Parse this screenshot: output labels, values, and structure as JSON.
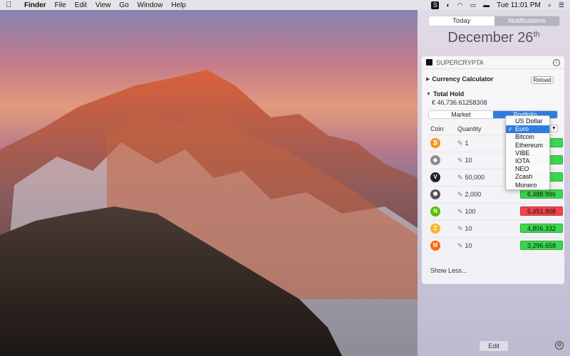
{
  "menubar": {
    "app": "Finder",
    "items": [
      "File",
      "Edit",
      "View",
      "Go",
      "Window",
      "Help"
    ],
    "clock": "Tue 11:01 PM"
  },
  "notification_center": {
    "tabs": {
      "today": "Today",
      "notifications": "Notifications"
    },
    "date_main": "December 26",
    "date_suffix": "th",
    "edit_label": "Edit"
  },
  "widget": {
    "title": "SUPERCRYPTA",
    "calculator_label": "Currency Calculator",
    "reload_label": "Reload",
    "total_hold_label": "Total Hold",
    "total_hold_value": "€ 46,736.61258308",
    "tab_market": "Market",
    "tab_portfolio": "Portfolio",
    "col_coin": "Coin",
    "col_quantity": "Quantity",
    "show_less": "Show Less...",
    "rows": [
      {
        "icon": "bitcoin-icon",
        "quantity": "1",
        "value": "",
        "trend": "up",
        "color": "#f7931a"
      },
      {
        "icon": "ethereum-icon",
        "quantity": "10",
        "value": "",
        "trend": "up",
        "color": "#8c8c8c"
      },
      {
        "icon": "vibe-icon",
        "quantity": "50,000",
        "value": "",
        "trend": "up",
        "color": "#222222"
      },
      {
        "icon": "iota-icon",
        "quantity": "2,000",
        "value": "6,488.996",
        "trend": "up",
        "color": "#555555"
      },
      {
        "icon": "neo-icon",
        "quantity": "100",
        "value": "5,451.908",
        "trend": "down",
        "color": "#58bf00"
      },
      {
        "icon": "zcash-icon",
        "quantity": "10",
        "value": "4,806.332",
        "trend": "up",
        "color": "#f4b728"
      },
      {
        "icon": "monero-icon",
        "quantity": "10",
        "value": "3,296.658",
        "trend": "up",
        "color": "#ff6600"
      }
    ]
  },
  "currency_dropdown": {
    "selected": "Euro",
    "options": [
      "US Dollar",
      "Euro",
      "Bitcoin",
      "Ethereum",
      "VIBE",
      "IOTA",
      "NEO",
      "Zcash",
      "Monero"
    ]
  }
}
